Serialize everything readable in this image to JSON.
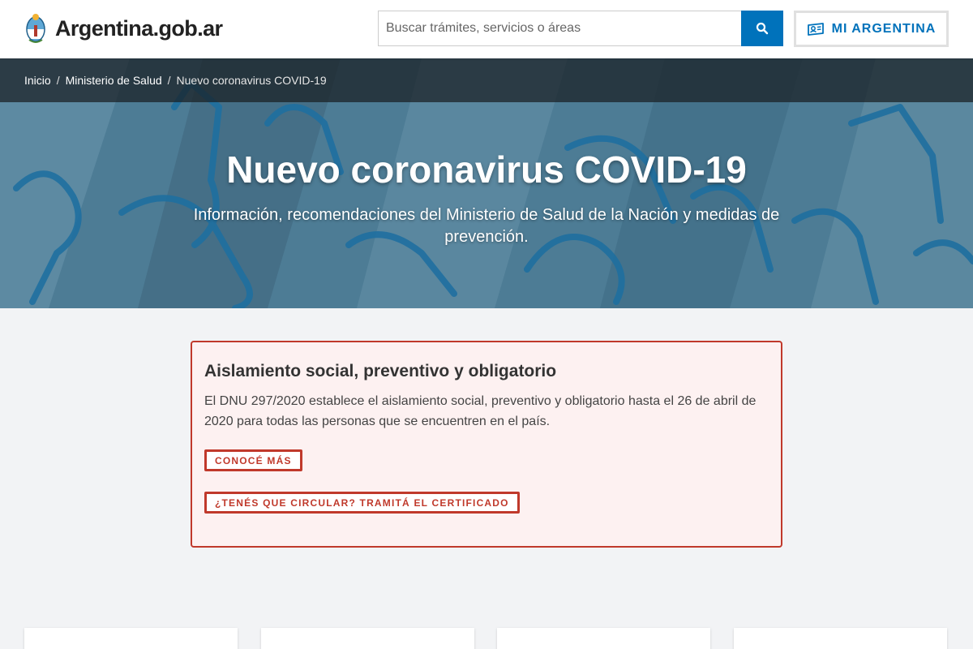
{
  "header": {
    "logo_text": "Argentina.gob.ar",
    "search_placeholder": "Buscar trámites, servicios o áreas",
    "mi_argentina_label": "MI ARGENTINA"
  },
  "breadcrumb": [
    {
      "label": "Inicio"
    },
    {
      "label": "Ministerio de Salud"
    },
    {
      "label": "Nuevo coronavirus COVID-19"
    }
  ],
  "hero": {
    "title": "Nuevo coronavirus COVID-19",
    "subtitle": "Información, recomendaciones del Ministerio de Salud de la Nación y medidas de prevención."
  },
  "alert": {
    "title": "Aislamiento social, preventivo y obligatorio",
    "text": "El DNU 297/2020 establece el aislamiento social, preventivo y obligatorio hasta el 26 de abril de 2020 para todas las personas que se encuentren en el país.",
    "button_1": "CONOCÉ MÁS",
    "button_2": "¿TENÉS QUE CIRCULAR? TRAMITÁ EL CERTIFICADO"
  },
  "colors": {
    "primary": "#0072bb",
    "danger": "#c0392b",
    "hero_bg": "#3e6f8a"
  }
}
